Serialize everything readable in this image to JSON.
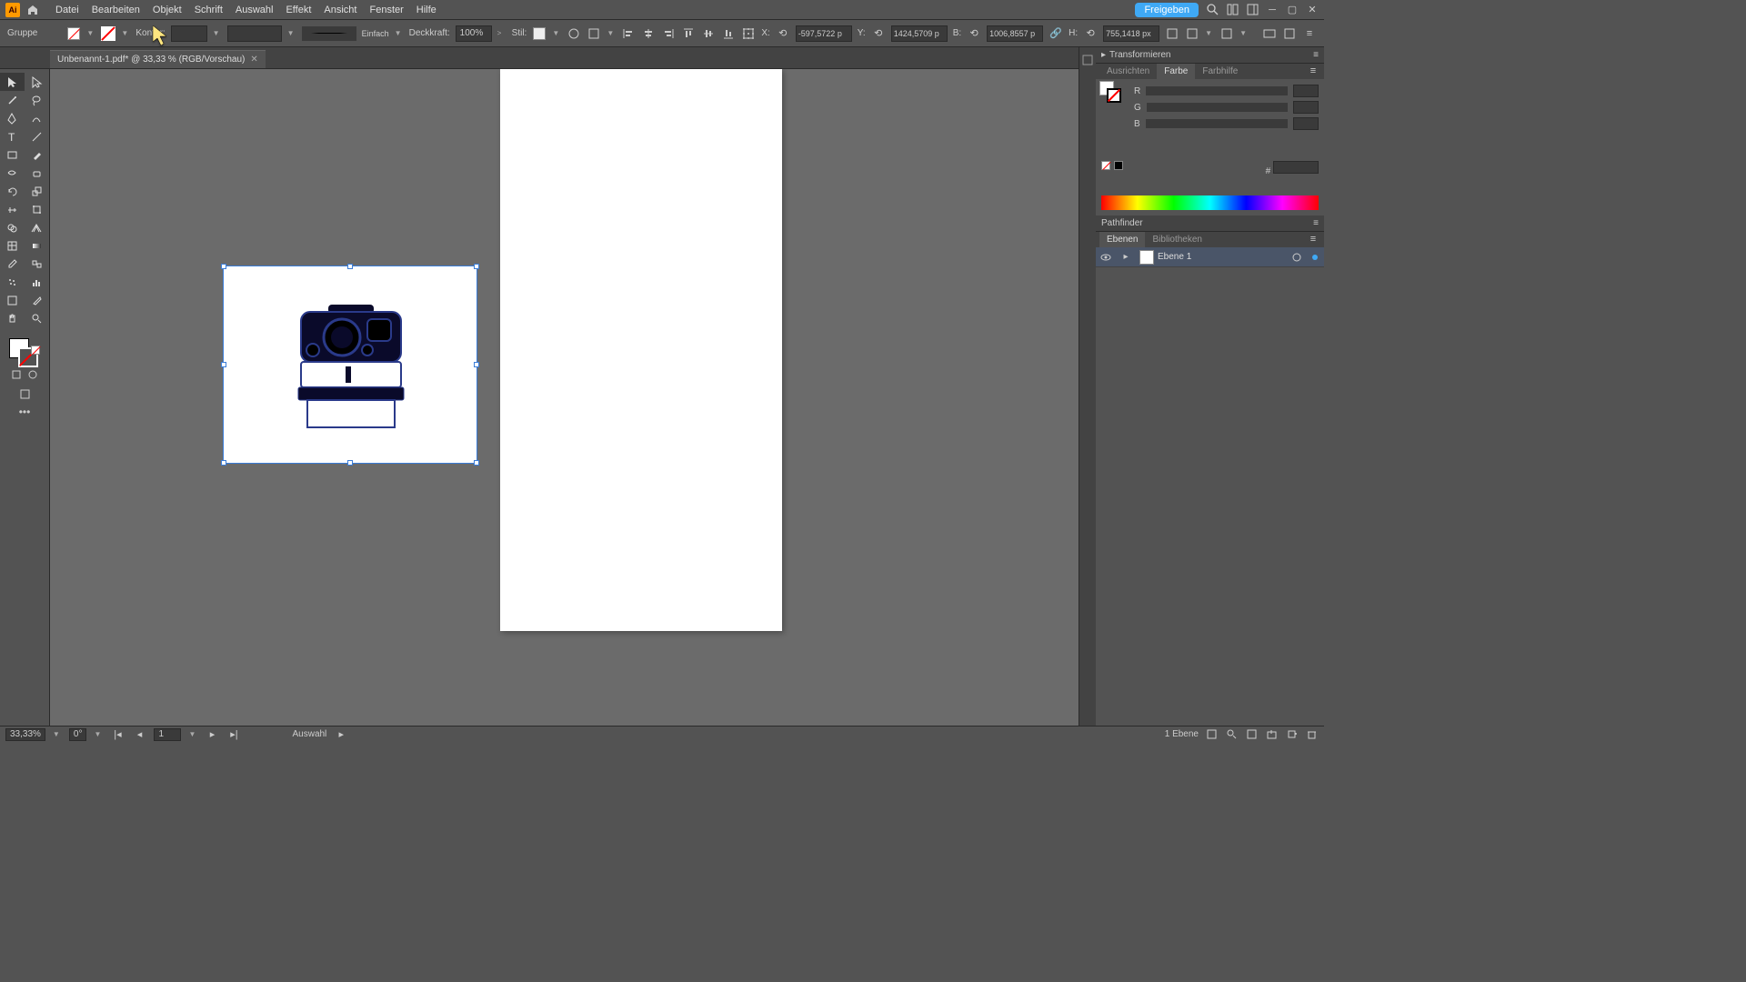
{
  "menu": {
    "items": [
      "Datei",
      "Bearbeiten",
      "Objekt",
      "Schrift",
      "Auswahl",
      "Effekt",
      "Ansicht",
      "Fenster",
      "Hilfe"
    ],
    "share": "Freigeben"
  },
  "control": {
    "selection_type": "Gruppe",
    "stroke_label": "Kontur:",
    "brush_style": "Einfach",
    "opacity_label": "Deckkraft:",
    "opacity_value": "100%",
    "style_label": "Stil:",
    "x_label": "X:",
    "x_value": "-597,5722 p",
    "y_label": "Y:",
    "y_value": "1424,5709 p",
    "w_label": "B:",
    "w_value": "1006,8557 p",
    "h_label": "H:",
    "h_value": "755,1418 px"
  },
  "tab": {
    "title": "Unbenannt-1.pdf* @ 33,33 % (RGB/Vorschau)"
  },
  "panels": {
    "transform": "Transformieren",
    "align": "Ausrichten",
    "color": "Farbe",
    "colorguide": "Farbhilfe",
    "pathfinder": "Pathfinder",
    "layers": "Ebenen",
    "libraries": "Bibliotheken",
    "rgb": {
      "r": "R",
      "g": "G",
      "b": "B",
      "hex": "#"
    },
    "layer1": "Ebene 1"
  },
  "status": {
    "zoom": "33,33%",
    "rotation": "0°",
    "artboard_num": "1",
    "tool": "Auswahl",
    "layer_count": "1 Ebene"
  }
}
